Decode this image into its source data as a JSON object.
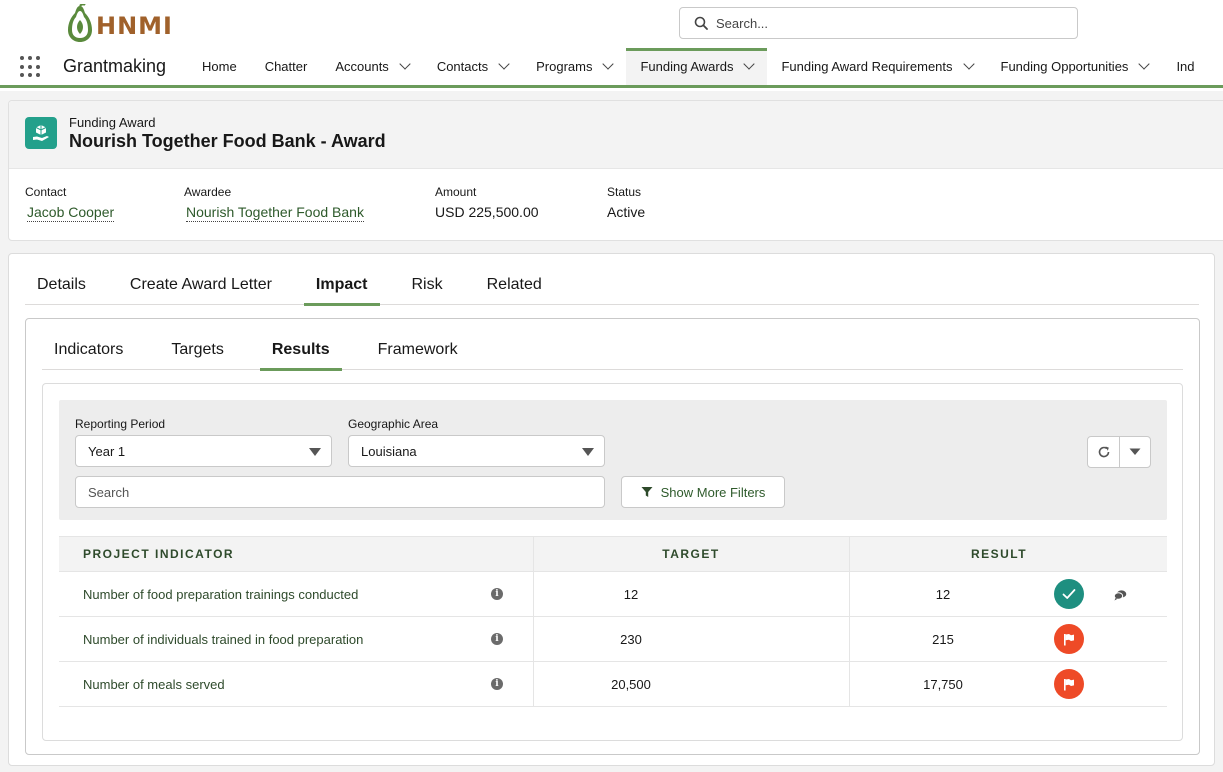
{
  "brand": {
    "logo_text": "HNMI",
    "accent": "#6b9b5b",
    "logo_color": "#a0612b"
  },
  "search": {
    "placeholder": "Search..."
  },
  "nav": {
    "app_name": "Grantmaking",
    "items": [
      {
        "label": "Home",
        "dropdown": false,
        "active": false
      },
      {
        "label": "Chatter",
        "dropdown": false,
        "active": false
      },
      {
        "label": "Accounts",
        "dropdown": true,
        "active": false
      },
      {
        "label": "Contacts",
        "dropdown": true,
        "active": false
      },
      {
        "label": "Programs",
        "dropdown": true,
        "active": false
      },
      {
        "label": "Funding Awards",
        "dropdown": true,
        "active": true
      },
      {
        "label": "Funding Award Requirements",
        "dropdown": true,
        "active": false
      },
      {
        "label": "Funding Opportunities",
        "dropdown": true,
        "active": false
      },
      {
        "label": "Ind",
        "dropdown": false,
        "active": false
      }
    ]
  },
  "record": {
    "type": "Funding Award",
    "title": "Nourish Together Food Bank - Award",
    "fields": {
      "contact": {
        "label": "Contact",
        "value": "Jacob Cooper"
      },
      "awardee": {
        "label": "Awardee",
        "value": "Nourish Together Food Bank"
      },
      "amount": {
        "label": "Amount",
        "value": "USD 225,500.00"
      },
      "status": {
        "label": "Status",
        "value": "Active"
      }
    }
  },
  "tabs": [
    {
      "label": "Details",
      "active": false
    },
    {
      "label": "Create Award Letter",
      "active": false
    },
    {
      "label": "Impact",
      "active": true
    },
    {
      "label": "Risk",
      "active": false
    },
    {
      "label": "Related",
      "active": false
    }
  ],
  "subtabs": [
    {
      "label": "Indicators",
      "active": false
    },
    {
      "label": "Targets",
      "active": false
    },
    {
      "label": "Results",
      "active": true
    },
    {
      "label": "Framework",
      "active": false
    }
  ],
  "filters": {
    "reporting_period": {
      "label": "Reporting Period",
      "value": "Year 1"
    },
    "geographic_area": {
      "label": "Geographic Area",
      "value": "Louisiana"
    },
    "search_placeholder": "Search",
    "more_filters_label": "Show More Filters"
  },
  "table": {
    "headers": {
      "indicator": "PROJECT INDICATOR",
      "target": "TARGET",
      "result": "RESULT"
    },
    "rows": [
      {
        "indicator": "Number of food preparation trainings conducted",
        "target": "12",
        "result": "12",
        "status": "check-icon",
        "has_comment": true
      },
      {
        "indicator": "Number of individuals trained in food preparation",
        "target": "230",
        "result": "215",
        "status": "flag-icon",
        "has_comment": false
      },
      {
        "indicator": "Number of meals served",
        "target": "20,500",
        "result": "17,750",
        "status": "flag-icon",
        "has_comment": false
      }
    ]
  }
}
